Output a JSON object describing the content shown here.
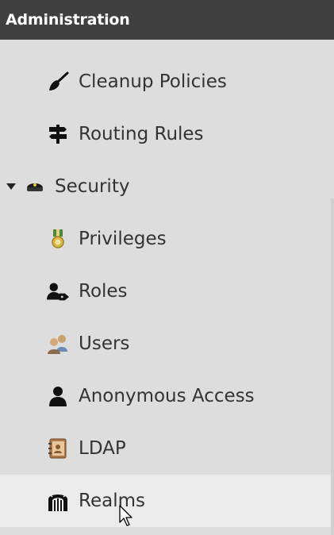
{
  "header": {
    "title": "Administration"
  },
  "nav": {
    "items": [
      {
        "label": "Cleanup Policies",
        "icon": "broom-icon"
      },
      {
        "label": "Routing Rules",
        "icon": "signpost-icon"
      },
      {
        "label": "Security",
        "icon": "police-cap-icon",
        "expanded": true
      },
      {
        "label": "Privileges",
        "icon": "medal-icon"
      },
      {
        "label": "Roles",
        "icon": "user-tag-icon"
      },
      {
        "label": "Users",
        "icon": "users-icon"
      },
      {
        "label": "Anonymous Access",
        "icon": "user-icon"
      },
      {
        "label": "LDAP",
        "icon": "address-book-icon"
      },
      {
        "label": "Realms",
        "icon": "gate-icon",
        "selected": true
      }
    ]
  },
  "colors": {
    "header_bg": "#404040",
    "sidebar_bg": "#dddddd",
    "selected_bg": "#ebebeb",
    "text": "#333333"
  }
}
